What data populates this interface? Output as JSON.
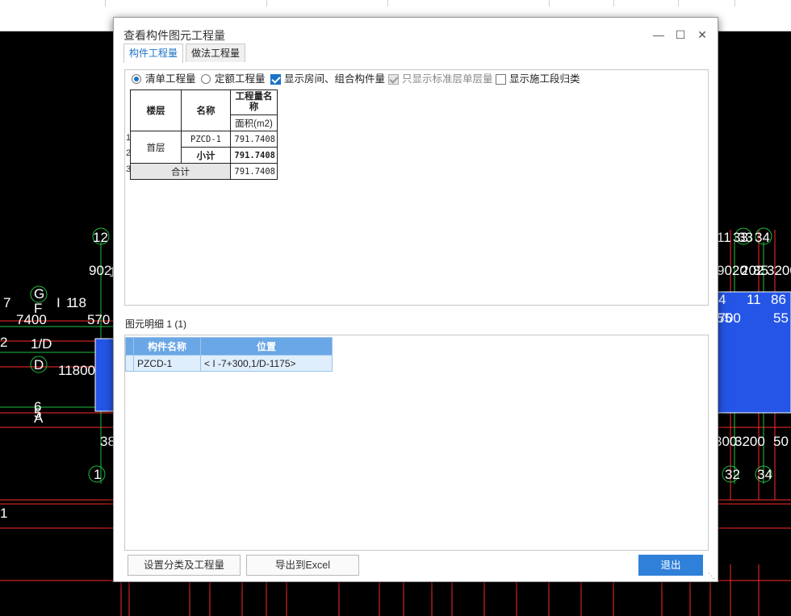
{
  "colors": {
    "accent": "#1a73c9",
    "header_blue": "#6aa7e6",
    "cad_red": "#ff2a2a",
    "cad_green": "#1fbf3f",
    "cad_fill": "#2455e6"
  },
  "cad": {
    "labels": [
      "12",
      "11",
      "33",
      "33",
      "34",
      "902",
      "9020",
      "202",
      "85",
      "3200",
      "7",
      "G",
      "F",
      "I",
      "1",
      "18",
      "7400",
      "570",
      "1/D",
      "D",
      "11800",
      "6",
      "5",
      "A",
      "38",
      "300",
      "3200",
      "50",
      "1",
      "32",
      "34",
      "1",
      "1",
      "4",
      "11",
      "86",
      "55",
      "5700",
      "55",
      "2"
    ]
  },
  "dialog": {
    "title": "查看构件图元工程量",
    "minimize_icon": "minimize-icon",
    "maximize_icon": "maximize-icon",
    "close_icon": "close-icon",
    "tabs": [
      "构件工程量",
      "做法工程量"
    ],
    "active_tab": 0,
    "options": [
      {
        "label": "清单工程量",
        "type": "radio",
        "checked": true
      },
      {
        "label": "定额工程量",
        "type": "radio",
        "checked": false
      },
      {
        "label": "显示房间、组合构件量",
        "type": "checkbox",
        "checked": true
      },
      {
        "label": "只显示标准层单层量",
        "type": "checkbox",
        "checked": true,
        "disabled": true
      },
      {
        "label": "显示施工段归类",
        "type": "checkbox",
        "checked": false
      }
    ],
    "quantity_table": {
      "h_floor": "楼层",
      "h_name": "名称",
      "h_qty": "工程量名称",
      "h_area": "面积(m2)",
      "row_numbers": [
        "1",
        "2",
        "3"
      ],
      "floor": "首层",
      "rows": [
        {
          "name": "PZCD-1",
          "area": "791.7408"
        },
        {
          "name": "小计",
          "area": "791.7408"
        }
      ],
      "total_label": "合计",
      "total_area": "791.7408"
    },
    "detail": {
      "title": "图元明细  1 (1)",
      "col_name": "构件名称",
      "col_pos": "位置",
      "row_number": "1",
      "rows": [
        {
          "name": "PZCD-1",
          "pos": "< I -7+300,1/D-1175>"
        }
      ]
    },
    "buttons": {
      "settings": "设置分类及工程量",
      "export": "导出到Excel",
      "exit": "退出"
    }
  }
}
